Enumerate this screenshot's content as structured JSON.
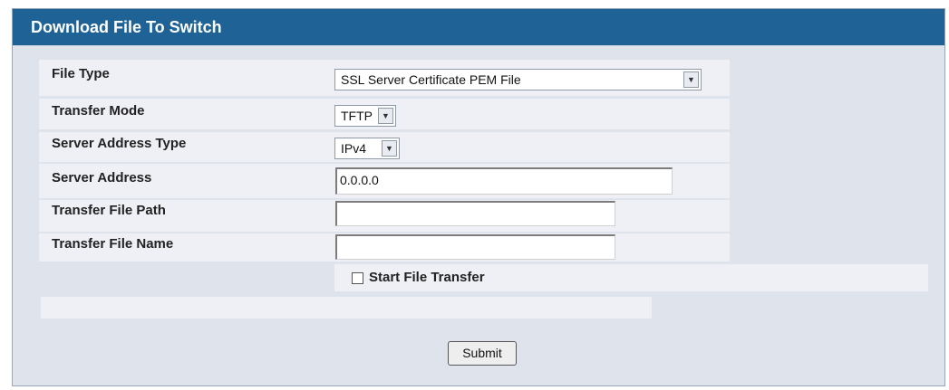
{
  "panel": {
    "title": "Download File To Switch"
  },
  "form": {
    "file_type": {
      "label": "File Type",
      "value": "SSL Server Certificate PEM File"
    },
    "transfer_mode": {
      "label": "Transfer Mode",
      "value": "TFTP"
    },
    "server_address_type": {
      "label": "Server Address Type",
      "value": "IPv4"
    },
    "server_address": {
      "label": "Server Address",
      "value": "0.0.0.0"
    },
    "transfer_file_path": {
      "label": "Transfer File Path",
      "value": ""
    },
    "transfer_file_name": {
      "label": "Transfer File Name",
      "value": ""
    },
    "start_transfer": {
      "label": "Start File Transfer",
      "checked": false
    },
    "status_text": "",
    "submit_label": "Submit"
  },
  "icons": {
    "dropdown": "chevron-down-icon"
  },
  "colors": {
    "title_bar": "#1f6295",
    "panel_bg": "#dfe3ec",
    "row_bg": "#eef0f5"
  }
}
